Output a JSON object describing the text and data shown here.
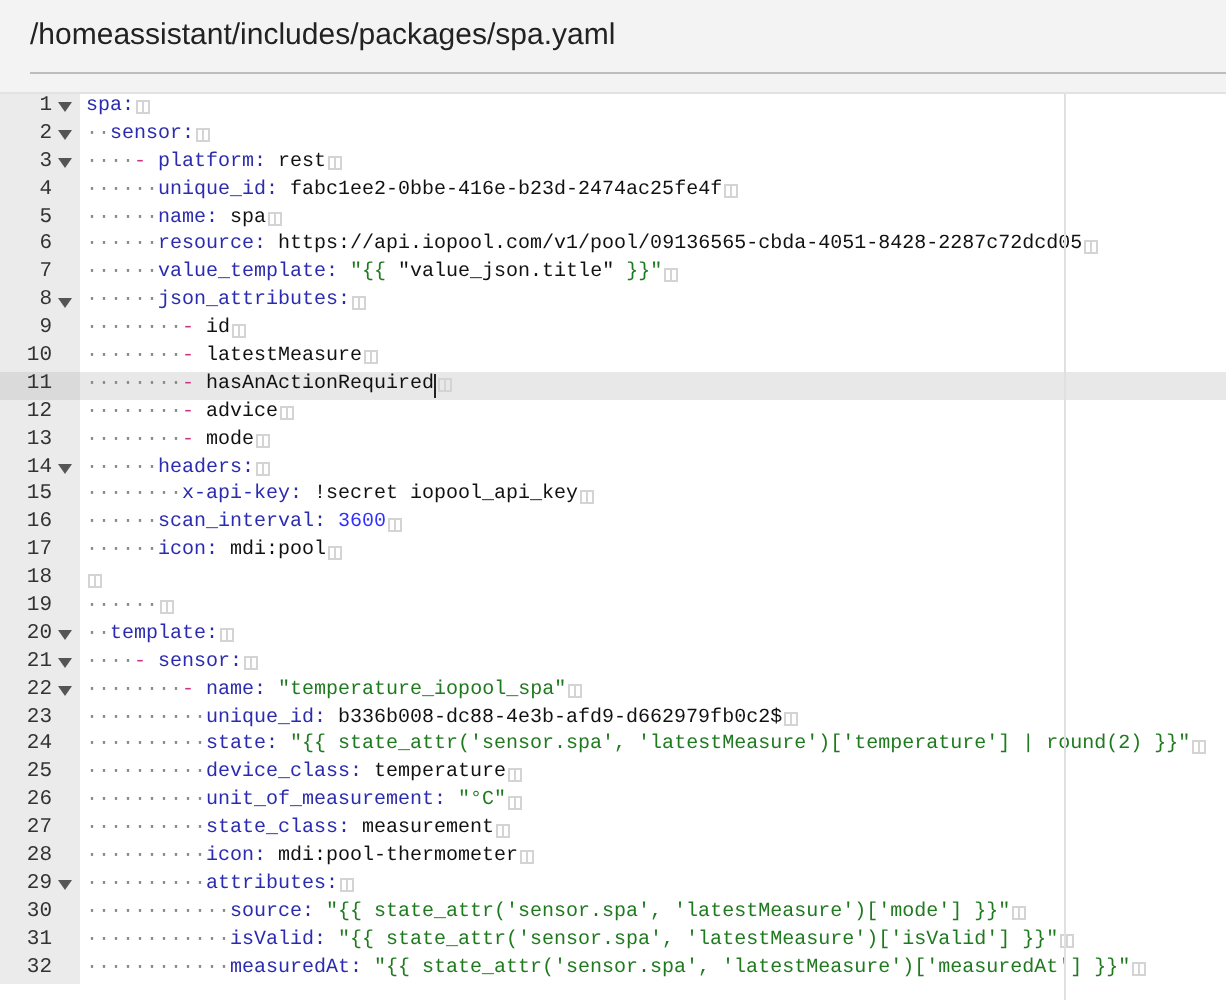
{
  "header": {
    "file_path": "/homeassistant/includes/packages/spa.yaml"
  },
  "editor": {
    "lines": [
      {
        "number": "1",
        "foldable": true,
        "active": false,
        "cursor": false,
        "tokens": [
          {
            "kind": "key",
            "text": "spa:"
          }
        ]
      },
      {
        "number": "2",
        "foldable": true,
        "active": false,
        "cursor": false,
        "indent": "··",
        "tokens": [
          {
            "kind": "key",
            "text": "sensor:"
          }
        ]
      },
      {
        "number": "3",
        "foldable": true,
        "active": false,
        "cursor": false,
        "indent": "····",
        "tokens": [
          {
            "kind": "dash",
            "text": "- "
          },
          {
            "kind": "key",
            "text": "platform: "
          },
          {
            "kind": "plain",
            "text": "rest"
          }
        ]
      },
      {
        "number": "4",
        "foldable": false,
        "active": false,
        "cursor": false,
        "indent": "······",
        "tokens": [
          {
            "kind": "key",
            "text": "unique_id: "
          },
          {
            "kind": "plain",
            "text": "fabc1ee2-0bbe-416e-b23d-2474ac25fe4f"
          }
        ]
      },
      {
        "number": "5",
        "foldable": false,
        "active": false,
        "cursor": false,
        "indent": "······",
        "tokens": [
          {
            "kind": "key",
            "text": "name: "
          },
          {
            "kind": "plain",
            "text": "spa"
          }
        ]
      },
      {
        "number": "6",
        "foldable": false,
        "active": false,
        "cursor": false,
        "indent": "······",
        "tokens": [
          {
            "kind": "key",
            "text": "resource: "
          },
          {
            "kind": "plain",
            "text": "https://api.iopool.com/v1/pool/09136565-cbda-4051-8428-2287c72dcd05"
          }
        ]
      },
      {
        "number": "7",
        "foldable": false,
        "active": false,
        "cursor": false,
        "indent": "······",
        "tokens": [
          {
            "kind": "key",
            "text": "value_template: "
          },
          {
            "kind": "string",
            "text": "\"{{ "
          },
          {
            "kind": "plain",
            "text": "\"value_json.title\" "
          },
          {
            "kind": "string",
            "text": "}}\""
          }
        ]
      },
      {
        "number": "8",
        "foldable": true,
        "active": false,
        "cursor": false,
        "indent": "······",
        "tokens": [
          {
            "kind": "key",
            "text": "json_attributes:"
          }
        ]
      },
      {
        "number": "9",
        "foldable": false,
        "active": false,
        "cursor": false,
        "indent": "········",
        "tokens": [
          {
            "kind": "dash",
            "text": "- "
          },
          {
            "kind": "plain",
            "text": "id"
          }
        ]
      },
      {
        "number": "10",
        "foldable": false,
        "active": false,
        "cursor": false,
        "indent": "········",
        "tokens": [
          {
            "kind": "dash",
            "text": "- "
          },
          {
            "kind": "plain",
            "text": "latestMeasure"
          }
        ]
      },
      {
        "number": "11",
        "foldable": false,
        "active": true,
        "cursor": true,
        "indent": "········",
        "tokens": [
          {
            "kind": "dash",
            "text": "- "
          },
          {
            "kind": "plain",
            "text": "hasAnActionRequired"
          }
        ]
      },
      {
        "number": "12",
        "foldable": false,
        "active": false,
        "cursor": false,
        "indent": "········",
        "tokens": [
          {
            "kind": "dash",
            "text": "- "
          },
          {
            "kind": "plain",
            "text": "advice"
          }
        ]
      },
      {
        "number": "13",
        "foldable": false,
        "active": false,
        "cursor": false,
        "indent": "········",
        "tokens": [
          {
            "kind": "dash",
            "text": "- "
          },
          {
            "kind": "plain",
            "text": "mode"
          }
        ]
      },
      {
        "number": "14",
        "foldable": true,
        "active": false,
        "cursor": false,
        "indent": "······",
        "tokens": [
          {
            "kind": "key",
            "text": "headers:"
          }
        ]
      },
      {
        "number": "15",
        "foldable": false,
        "active": false,
        "cursor": false,
        "indent": "········",
        "tokens": [
          {
            "kind": "key",
            "text": "x-api-key: "
          },
          {
            "kind": "plain",
            "text": "!secret iopool_api_key"
          }
        ]
      },
      {
        "number": "16",
        "foldable": false,
        "active": false,
        "cursor": false,
        "indent": "······",
        "tokens": [
          {
            "kind": "key",
            "text": "scan_interval: "
          },
          {
            "kind": "number",
            "text": "3600"
          }
        ]
      },
      {
        "number": "17",
        "foldable": false,
        "active": false,
        "cursor": false,
        "indent": "······",
        "tokens": [
          {
            "kind": "key",
            "text": "icon: "
          },
          {
            "kind": "plain",
            "text": "mdi:pool"
          }
        ]
      },
      {
        "number": "18",
        "foldable": false,
        "active": false,
        "cursor": false
      },
      {
        "number": "19",
        "foldable": false,
        "active": false,
        "cursor": false,
        "indent": "······"
      },
      {
        "number": "20",
        "foldable": true,
        "active": false,
        "cursor": false,
        "indent": "··",
        "tokens": [
          {
            "kind": "key",
            "text": "template:"
          }
        ]
      },
      {
        "number": "21",
        "foldable": true,
        "active": false,
        "cursor": false,
        "indent": "····",
        "tokens": [
          {
            "kind": "dash",
            "text": "- "
          },
          {
            "kind": "key",
            "text": "sensor:"
          }
        ]
      },
      {
        "number": "22",
        "foldable": true,
        "active": false,
        "cursor": false,
        "indent": "········",
        "tokens": [
          {
            "kind": "dash",
            "text": "- "
          },
          {
            "kind": "key",
            "text": "name: "
          },
          {
            "kind": "string",
            "text": "\"temperature_iopool_spa\""
          }
        ]
      },
      {
        "number": "23",
        "foldable": false,
        "active": false,
        "cursor": false,
        "indent": "··········",
        "tokens": [
          {
            "kind": "key",
            "text": "unique_id: "
          },
          {
            "kind": "plain",
            "text": "b336b008-dc88-4e3b-afd9-d662979fb0c2$"
          }
        ]
      },
      {
        "number": "24",
        "foldable": false,
        "active": false,
        "cursor": false,
        "indent": "··········",
        "tokens": [
          {
            "kind": "key",
            "text": "state: "
          },
          {
            "kind": "string",
            "text": "\"{{ state_attr('sensor.spa', 'latestMeasure')['temperature'] | round(2) }}\""
          }
        ]
      },
      {
        "number": "25",
        "foldable": false,
        "active": false,
        "cursor": false,
        "indent": "··········",
        "tokens": [
          {
            "kind": "key",
            "text": "device_class: "
          },
          {
            "kind": "plain",
            "text": "temperature"
          }
        ]
      },
      {
        "number": "26",
        "foldable": false,
        "active": false,
        "cursor": false,
        "indent": "··········",
        "tokens": [
          {
            "kind": "key",
            "text": "unit_of_measurement: "
          },
          {
            "kind": "string",
            "text": "\"°C\""
          }
        ]
      },
      {
        "number": "27",
        "foldable": false,
        "active": false,
        "cursor": false,
        "indent": "··········",
        "tokens": [
          {
            "kind": "key",
            "text": "state_class: "
          },
          {
            "kind": "plain",
            "text": "measurement"
          }
        ]
      },
      {
        "number": "28",
        "foldable": false,
        "active": false,
        "cursor": false,
        "indent": "··········",
        "tokens": [
          {
            "kind": "key",
            "text": "icon: "
          },
          {
            "kind": "plain",
            "text": "mdi:pool-thermometer"
          }
        ]
      },
      {
        "number": "29",
        "foldable": true,
        "active": false,
        "cursor": false,
        "indent": "··········",
        "tokens": [
          {
            "kind": "key",
            "text": "attributes:"
          }
        ]
      },
      {
        "number": "30",
        "foldable": false,
        "active": false,
        "cursor": false,
        "indent": "············",
        "tokens": [
          {
            "kind": "key",
            "text": "source: "
          },
          {
            "kind": "string",
            "text": "\"{{ state_attr('sensor.spa', 'latestMeasure')['mode'] }}\""
          }
        ]
      },
      {
        "number": "31",
        "foldable": false,
        "active": false,
        "cursor": false,
        "indent": "············",
        "tokens": [
          {
            "kind": "key",
            "text": "isValid: "
          },
          {
            "kind": "string",
            "text": "\"{{ state_attr('sensor.spa', 'latestMeasure')['isValid'] }}\""
          }
        ]
      },
      {
        "number": "32",
        "foldable": false,
        "active": false,
        "cursor": false,
        "indent": "············",
        "tokens": [
          {
            "kind": "key",
            "text": "measuredAt: "
          },
          {
            "kind": "string",
            "text": "\"{{ state_attr('sensor.spa', 'latestMeasure')['measuredAt'] }}\""
          }
        ]
      }
    ]
  }
}
